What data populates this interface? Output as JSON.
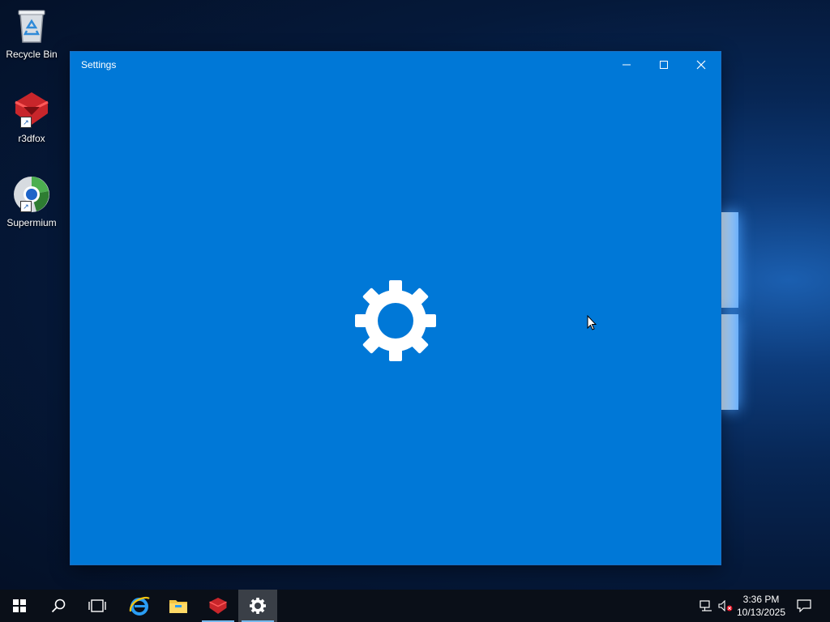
{
  "desktop": {
    "icons": [
      {
        "label": "Recycle Bin",
        "icon": "recycle-bin-icon"
      },
      {
        "label": "r3dfox",
        "icon": "r3dfox-icon"
      },
      {
        "label": "Supermium",
        "icon": "supermium-icon"
      }
    ]
  },
  "window": {
    "title": "Settings",
    "background": "#0078d7",
    "center_icon": "gear-icon"
  },
  "taskbar": {
    "items": [
      "start-icon",
      "search-icon",
      "task-view-icon",
      "internet-explorer-icon",
      "file-explorer-icon",
      "r3dfox-icon",
      "settings-icon"
    ],
    "clock": {
      "time": "3:36 PM",
      "date": "10/13/2025"
    },
    "tray": [
      "network-icon",
      "volume-muted-icon",
      "action-center-icon"
    ]
  }
}
